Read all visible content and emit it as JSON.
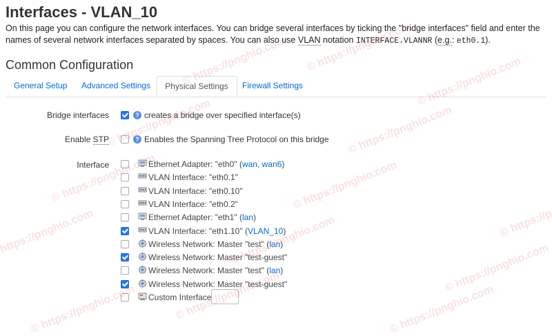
{
  "page": {
    "title": "Interfaces - VLAN_10",
    "desc_part1": "On this page you can configure the network interfaces. You can bridge several interfaces by ticking the \"bridge interfaces\" field and enter the names of several network interfaces separated by spaces. You can also use ",
    "desc_vlan": "VLAN",
    "desc_part2": " notation ",
    "desc_code1": "INTERFACE.VLANNR",
    "desc_part3": " (",
    "desc_eg": "e.g.",
    "desc_part4": ": ",
    "desc_code2": "eth0.1",
    "desc_part5": ")."
  },
  "section": {
    "title": "Common Configuration"
  },
  "tabs": [
    {
      "label": "General Setup",
      "active": false
    },
    {
      "label": "Advanced Settings",
      "active": false
    },
    {
      "label": "Physical Settings",
      "active": true
    },
    {
      "label": "Firewall Settings",
      "active": false
    }
  ],
  "bridge": {
    "label": "Bridge interfaces",
    "checked": true,
    "help": "creates a bridge over specified interface(s)"
  },
  "stp": {
    "label_prefix": "Enable ",
    "label_abbr": "STP",
    "checked": false,
    "help": "Enables the Spanning Tree Protocol on this bridge"
  },
  "interface_label": "Interface",
  "interfaces": [
    {
      "icon": "ethernet-icon",
      "text": "Ethernet Adapter: \"eth0\"",
      "links": "wan, wan6",
      "checked": false
    },
    {
      "icon": "vlan-icon",
      "text": "VLAN Interface: \"eth0.1\"",
      "links": "",
      "checked": false
    },
    {
      "icon": "vlan-icon",
      "text": "VLAN Interface: \"eth0.10\"",
      "links": "",
      "checked": false
    },
    {
      "icon": "vlan-icon",
      "text": "VLAN Interface: \"eth0.2\"",
      "links": "",
      "checked": false
    },
    {
      "icon": "ethernet-icon",
      "text": "Ethernet Adapter: \"eth1\"",
      "links": "lan",
      "checked": false
    },
    {
      "icon": "vlan-icon",
      "text": "VLAN Interface: \"eth1.10\"",
      "links": "VLAN_10",
      "checked": true
    },
    {
      "icon": "wifi-icon",
      "text": "Wireless Network: Master \"test\"",
      "links": "lan",
      "checked": false
    },
    {
      "icon": "wifi-icon",
      "text": "Wireless Network: Master \"test-guest\"",
      "links": "",
      "checked": true
    },
    {
      "icon": "wifi-icon",
      "text": "Wireless Network: Master \"test\"",
      "links": "lan",
      "checked": false
    },
    {
      "icon": "wifi-icon",
      "text": "Wireless Network: Master \"test-guest\"",
      "links": "",
      "checked": true
    },
    {
      "icon": "custom-icon",
      "text": "Custom Interface:",
      "links": "",
      "checked": false
    }
  ],
  "custom_input": {
    "value": "",
    "placeholder": ""
  },
  "watermark": {
    "text": "© https://pnghio.com"
  },
  "colors": {
    "link": "#0069d6",
    "checkbox_checked": "#2a7ae2",
    "watermark": "#dc5a5a"
  }
}
